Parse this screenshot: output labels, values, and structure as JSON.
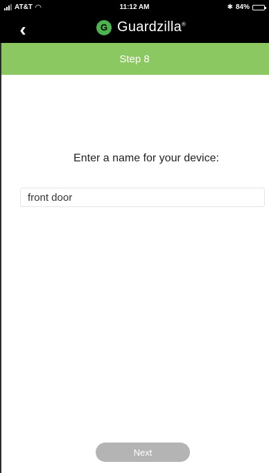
{
  "status_bar": {
    "carrier": "AT&T",
    "time": "11:12 AM",
    "bluetooth": "✱",
    "battery_text": "84%",
    "battery_level": 0.84
  },
  "nav": {
    "back_glyph": "‹",
    "logo_glyph": "G",
    "brand": "Guardzilla",
    "brand_mark": "®"
  },
  "step": {
    "title": "Step 8"
  },
  "form": {
    "prompt": "Enter a name for your device:",
    "device_name_value": "front door"
  },
  "actions": {
    "next_label": "Next"
  },
  "colors": {
    "topbar": "#000000",
    "stepbar": "#8cc862",
    "logo": "#4cb34f",
    "button": "#b4b4b4"
  }
}
